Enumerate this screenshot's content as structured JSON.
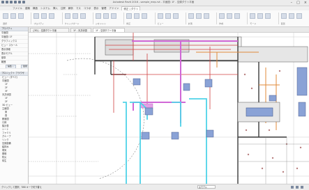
{
  "app": {
    "title": "Autodesk Revit 2016 - sample_mep.rvt - 平面図: 1F - 空調ダクト平面"
  },
  "ribbon": {
    "tabs": [
      "ファイル",
      "建築",
      "構造",
      "システム",
      "挿入",
      "注釈",
      "解析",
      "マス",
      "コラボ",
      "表示",
      "管理",
      "アドイン",
      "修正 | ダクト"
    ],
    "active_tab": "修正 | ダクト",
    "groups": [
      "選択",
      "プロパティ",
      "クリップボード",
      "ジオメトリ",
      "修正",
      "ビュー",
      "計測",
      "作成",
      "モード",
      "配置"
    ]
  },
  "properties_panel": {
    "header": "プロパティ",
    "rows": [
      "平面図",
      "平面図: 1F",
      "グラフィックス",
      "ビュー スケール",
      "表示詳細",
      "表示モデル",
      "基準",
      "範囲"
    ],
    "edit_button": "編集...",
    "apply_button": "適用"
  },
  "project_browser": {
    "header": "プロジェクト ブラウザ",
    "items": [
      {
        "label": "ビュー (すべて)",
        "indent": false
      },
      {
        "label": "平面図",
        "indent": false
      },
      {
        "label": "1F",
        "indent": true
      },
      {
        "label": "2F",
        "indent": true
      },
      {
        "label": "3F",
        "indent": true
      },
      {
        "label": "天井伏図",
        "indent": false
      },
      {
        "label": "1F",
        "indent": true
      },
      {
        "label": "2F",
        "indent": true
      },
      {
        "label": "3D ビュー",
        "indent": false
      },
      {
        "label": "立面図",
        "indent": false
      },
      {
        "label": "東",
        "indent": true
      },
      {
        "label": "西",
        "indent": true
      },
      {
        "label": "断面図",
        "indent": false
      },
      {
        "label": "凡例",
        "indent": false
      },
      {
        "label": "集計表",
        "indent": false
      },
      {
        "label": "シート",
        "indent": false
      },
      {
        "label": "ファミリ",
        "indent": false
      },
      {
        "label": "グループ",
        "indent": false
      },
      {
        "label": "リンク",
        "indent": false
      },
      {
        "label": "空調設備",
        "indent": false
      },
      {
        "label": "給排水",
        "indent": false
      },
      {
        "label": "電気",
        "indent": false
      },
      {
        "label": "照明",
        "indent": false
      },
      {
        "label": "防災",
        "indent": false
      },
      {
        "label": "衛生",
        "indent": false
      }
    ]
  },
  "view_tabs": [
    "{3D} - 空調ダクト平面",
    "1F - 天井伏図",
    "1F - 空調ダクト平面"
  ],
  "active_view_tab": "1F - 空調ダクト平面",
  "status": {
    "text": "クリックして選択、TAB キーで切り替え",
    "view_combo": "主モデル"
  },
  "colors": {
    "duct_cyan": "#4fd3e8",
    "pipe_magenta": "#d067d6",
    "pipe_red": "#d04040",
    "duct_orange": "#e08a3a",
    "equipment_blue": "#8aa2d6",
    "wall_dark": "#3a3a3a"
  }
}
